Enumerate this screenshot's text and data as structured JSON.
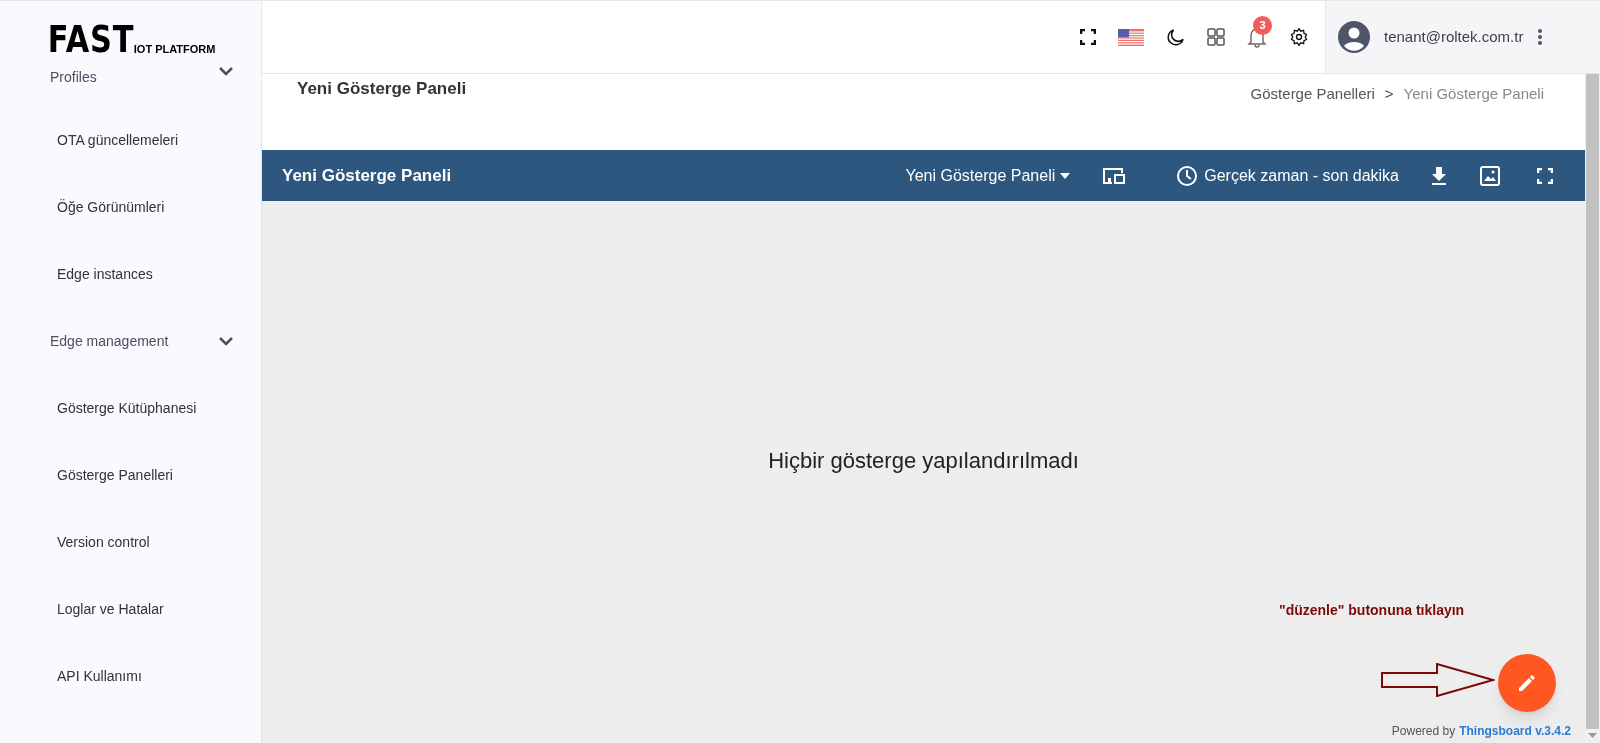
{
  "logo": {
    "main": "FAST",
    "sub": "IOT PLATFORM"
  },
  "sidebar": {
    "items": [
      {
        "kind": "group",
        "label": "Profiles",
        "expanded": true
      },
      {
        "kind": "link",
        "label": "OTA güncellemeleri"
      },
      {
        "kind": "link",
        "label": "Öğe Görünümleri"
      },
      {
        "kind": "link",
        "label": "Edge instances"
      },
      {
        "kind": "group",
        "label": "Edge management",
        "expanded": true
      },
      {
        "kind": "link",
        "label": "Gösterge Kütüphanesi"
      },
      {
        "kind": "link",
        "label": "Gösterge Panelleri"
      },
      {
        "kind": "link",
        "label": "Version control"
      },
      {
        "kind": "link",
        "label": "Loglar ve Hatalar"
      },
      {
        "kind": "link",
        "label": "API Kullanımı"
      }
    ]
  },
  "header": {
    "notification_count": "3",
    "user": "tenant@roltek.com.tr"
  },
  "page": {
    "title": "Yeni Gösterge Paneli",
    "breadcrumb": [
      {
        "label": "Gösterge Panelleri",
        "selected": false
      },
      {
        "label": "Yeni Gösterge Paneli",
        "selected": true
      }
    ],
    "breadcrumb_separator": ">"
  },
  "toolbar": {
    "title": "Yeni Gösterge Paneli",
    "state_select": "Yeni Gösterge Paneli",
    "timewindow": "Gerçek zaman - son dakika"
  },
  "dashboard": {
    "empty_message": "Hiçbir gösterge yapılandırılmadı",
    "annotation": "\"düzenle\" butonuna tıklayın"
  },
  "footer": {
    "powered_by": "Powered by",
    "brand": "Thingsboard v.3.4.2"
  }
}
